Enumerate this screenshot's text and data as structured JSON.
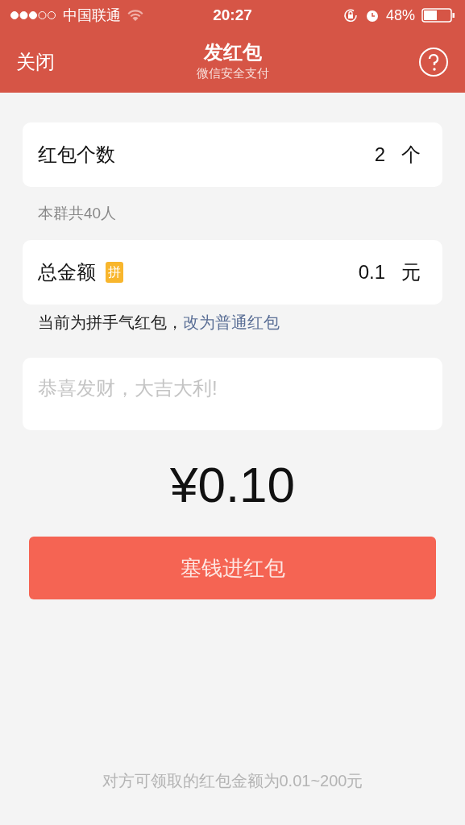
{
  "status_bar": {
    "carrier": "中国联通",
    "time": "20:27",
    "battery": "48%"
  },
  "nav": {
    "close": "关闭",
    "title": "发红包",
    "subtitle": "微信安全支付"
  },
  "count": {
    "label": "红包个数",
    "value": "2",
    "unit": "个"
  },
  "count_hint": "本群共40人",
  "amount": {
    "label": "总金额",
    "badge": "拼",
    "value": "0.1",
    "unit": "元"
  },
  "mode_note": {
    "text": "当前为拼手气红包，",
    "link": "改为普通红包"
  },
  "message": {
    "placeholder": "恭喜发财，大吉大利!"
  },
  "total": "¥0.10",
  "submit": "塞钱进红包",
  "footer": "对方可领取的红包金额为0.01~200元"
}
